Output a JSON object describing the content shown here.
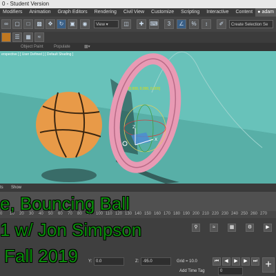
{
  "window": {
    "title": "0 - Student Version",
    "user": "adam"
  },
  "menu": {
    "items": [
      "Modifiers",
      "Animation",
      "Graph Editors",
      "Rendering",
      "Civil View",
      "Customize",
      "Scripting",
      "Interactive",
      "Content"
    ]
  },
  "toolbar": {
    "view_dropdown": "View",
    "selection_set": "Create Selection Se"
  },
  "ribbon": {
    "object_paint": "Object Paint",
    "populate": "Populate"
  },
  "viewport": {
    "label": "erspective ] [ User Defined ] [ Default Shading ]",
    "coords": "[0.000, 0.000, 0.000]"
  },
  "timeline": {
    "tabs_label": "ts",
    "show_label": "Show",
    "ticks": [
      "0",
      "10",
      "20",
      "30",
      "40",
      "50",
      "60",
      "70",
      "80",
      "90",
      "100",
      "110",
      "120",
      "130",
      "140",
      "150",
      "160",
      "170",
      "180",
      "190",
      "200",
      "210",
      "220",
      "230",
      "240",
      "250",
      "260",
      "270"
    ]
  },
  "status": {
    "y_label": "Y:",
    "y_value": "0.0",
    "z_label": "Z:",
    "z_value": "-95.0",
    "grid": "Grid = 10.0",
    "time_tag": "Add Time Tag",
    "frame_value": "0"
  },
  "caption": {
    "line1": "e, Bouncing Ball",
    "line2": "1 w/ Jon Simpson",
    "line3": "Fall 2019"
  },
  "colors": {
    "viewport_bg": "#5fb8b0",
    "caption_green": "#0a8c0a",
    "ring_pink": "#e89ab4",
    "ball_orange": "#e89a48"
  }
}
